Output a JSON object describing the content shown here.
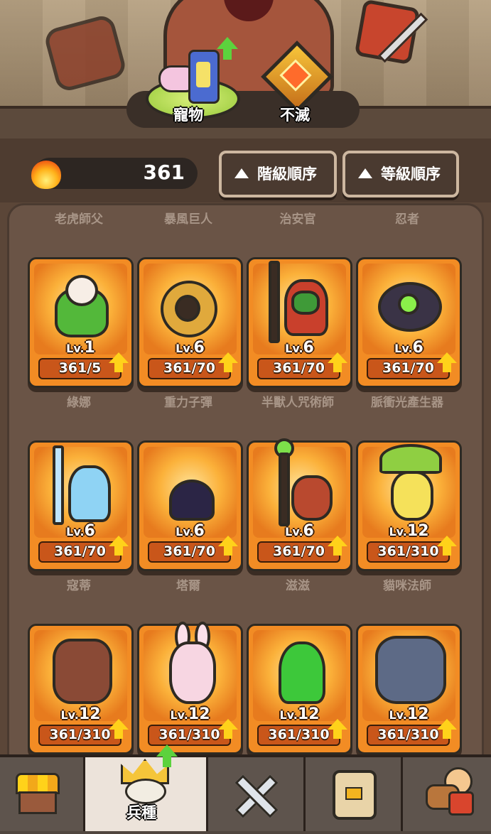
{
  "top_tabs": [
    {
      "label": "寵物"
    },
    {
      "label": "不滅"
    }
  ],
  "currency": {
    "icon": "fire-icon",
    "value": "361"
  },
  "sort_buttons": [
    {
      "label": "階級順序",
      "icon": "triangle-up-icon"
    },
    {
      "label": "等級順序",
      "icon": "triangle-up-icon"
    }
  ],
  "row_labels_top": [
    "老虎師父",
    "暴風巨人",
    "治安官",
    "忍者"
  ],
  "units": [
    {
      "level_prefix": "Lv.",
      "level": "1",
      "progress_text": "361/5",
      "name": "綠娜"
    },
    {
      "level_prefix": "Lv.",
      "level": "6",
      "progress_text": "361/70",
      "name": "重力子彈"
    },
    {
      "level_prefix": "Lv.",
      "level": "6",
      "progress_text": "361/70",
      "name": "半獸人咒術師"
    },
    {
      "level_prefix": "Lv.",
      "level": "6",
      "progress_text": "361/70",
      "name": "脈衝光產生器"
    },
    {
      "level_prefix": "Lv.",
      "level": "6",
      "progress_text": "361/70",
      "name": "寇蒂"
    },
    {
      "level_prefix": "Lv.",
      "level": "6",
      "progress_text": "361/70",
      "name": "塔爾"
    },
    {
      "level_prefix": "Lv.",
      "level": "6",
      "progress_text": "361/70",
      "name": "滋滋"
    },
    {
      "level_prefix": "Lv.",
      "level": "12",
      "progress_text": "361/310",
      "name": "貓咪法師"
    },
    {
      "level_prefix": "Lv.",
      "level": "12",
      "progress_text": "361/310",
      "name": ""
    },
    {
      "level_prefix": "Lv.",
      "level": "12",
      "progress_text": "361/310",
      "name": ""
    },
    {
      "level_prefix": "Lv.",
      "level": "12",
      "progress_text": "361/310",
      "name": ""
    },
    {
      "level_prefix": "Lv.",
      "level": "12",
      "progress_text": "361/310",
      "name": ""
    }
  ],
  "bottom_nav": [
    {
      "icon": "shop-icon",
      "label": ""
    },
    {
      "icon": "crown-icon",
      "label": "兵種",
      "active": true
    },
    {
      "icon": "crossed-swords-icon",
      "label": ""
    },
    {
      "icon": "card-icon",
      "label": ""
    },
    {
      "icon": "heroes-icon",
      "label": ""
    }
  ],
  "colors": {
    "card_orange": "#f28c24",
    "upgrade_arrow": "#ffd21a",
    "pet_arrow": "#5cd23d"
  }
}
